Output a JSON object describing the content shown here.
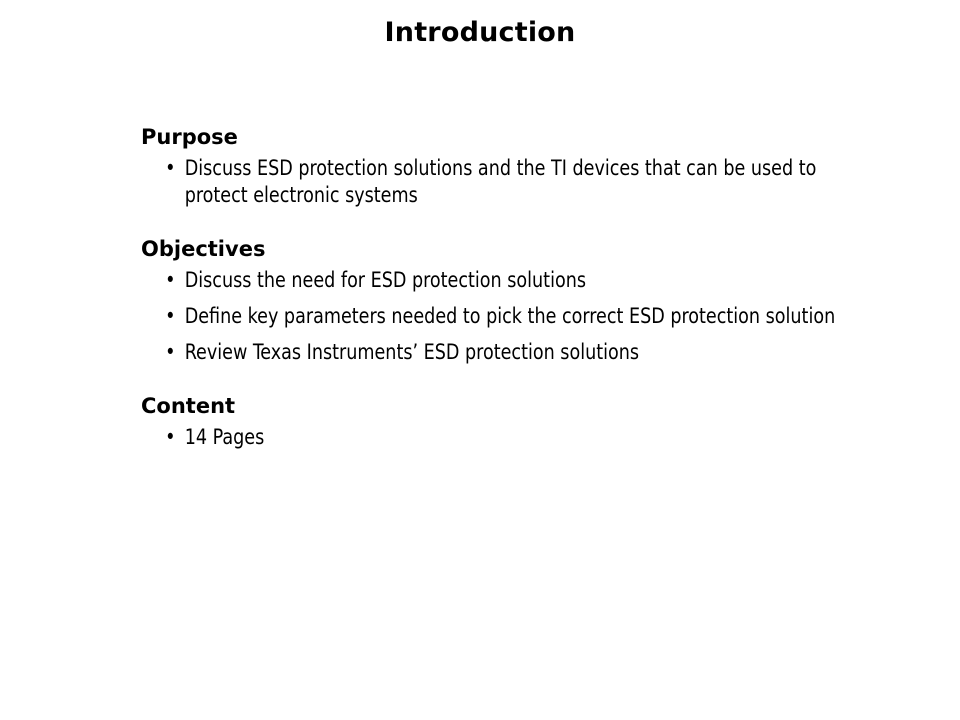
{
  "slide": {
    "title": "Introduction",
    "bullet_glyph": "•",
    "text_color": "#000000",
    "background_color": "#ffffff",
    "sections": [
      {
        "heading": "Purpose",
        "bullets": [
          "Discuss ESD protection solutions and the TI devices that can be used to protect electronic systems"
        ]
      },
      {
        "heading": "Objectives",
        "bullets": [
          "Discuss the need for ESD protection solutions",
          "Define key parameters needed to pick the correct ESD protection solution",
          "Review Texas Instruments’ ESD protection solutions"
        ]
      },
      {
        "heading": "Content",
        "bullets": [
          "14 Pages"
        ]
      }
    ]
  }
}
